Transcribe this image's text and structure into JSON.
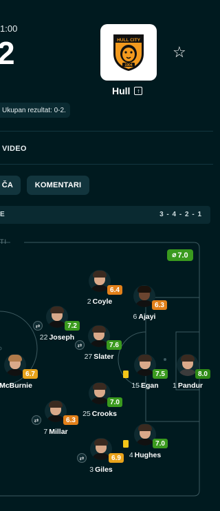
{
  "header": {
    "time": "1:00",
    "score": "2",
    "team": {
      "name": "Hull",
      "logo_text": "HULL CITY",
      "logo_year": "1904"
    },
    "aggregate": "Ukupan rezultat: 0-2.",
    "icons": {
      "favorite": "star-icon",
      "external": "external-link-icon"
    }
  },
  "tabs": {
    "video_label": "VIDEO"
  },
  "buttons": {
    "partial": "ČA",
    "comments": "KOMENTARI"
  },
  "lineup_bar": {
    "left": "E",
    "formation": "3 - 4 - 2 - 1"
  },
  "pitch": {
    "label": "TI",
    "team_rating": "7.0",
    "team_rating_icon": "no-symbol-icon",
    "players": [
      {
        "number": "2",
        "name": "Coyle",
        "rating": "6.4",
        "rating_color": "#e2801a",
        "card": false,
        "sub": false
      },
      {
        "number": "6",
        "name": "Ajayi",
        "rating": "6.3",
        "rating_color": "#e2801a",
        "card": false,
        "sub": false
      },
      {
        "number": "22",
        "name": "Joseph",
        "rating": "7.2",
        "rating_color": "#3a9a1e",
        "card": false,
        "sub": true
      },
      {
        "number": "27",
        "name": "Slater",
        "rating": "7.6",
        "rating_color": "#3a9a1e",
        "card": false,
        "sub": true
      },
      {
        "number": "",
        "name": "McBurnie",
        "rating": "6.7",
        "rating_color": "#e8a21a",
        "card": false,
        "sub": false
      },
      {
        "number": "15",
        "name": "Egan",
        "rating": "7.5",
        "rating_color": "#3a9a1e",
        "card": true,
        "sub": false
      },
      {
        "number": "1",
        "name": "Pandur",
        "rating": "8.0",
        "rating_color": "#2e8a16",
        "card": false,
        "sub": false
      },
      {
        "number": "25",
        "name": "Crooks",
        "rating": "7.0",
        "rating_color": "#3a9a1e",
        "card": false,
        "sub": false
      },
      {
        "number": "7",
        "name": "Millar",
        "rating": "6.3",
        "rating_color": "#e2801a",
        "card": false,
        "sub": true
      },
      {
        "number": "4",
        "name": "Hughes",
        "rating": "7.0",
        "rating_color": "#3a9a1e",
        "card": true,
        "sub": false
      },
      {
        "number": "3",
        "name": "Giles",
        "rating": "6.9",
        "rating_color": "#e8a21a",
        "card": false,
        "sub": true
      }
    ]
  }
}
